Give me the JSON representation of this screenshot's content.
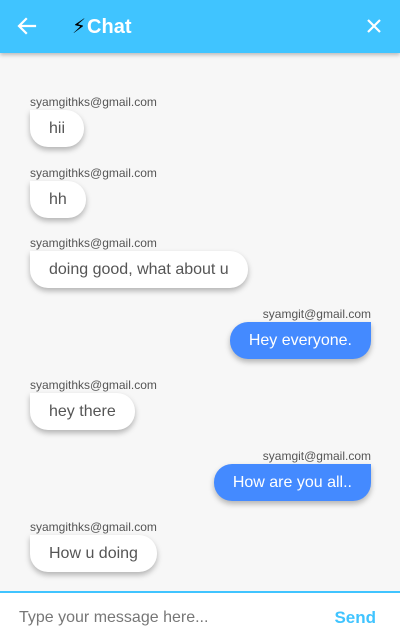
{
  "appbar": {
    "title": "Chat",
    "bolt_glyph": "⚡",
    "back_icon": "arrow-left-icon",
    "close_icon": "close-icon",
    "background_color": "#40c4ff"
  },
  "messages": [
    {
      "sender": "syamgithks@gmail.com",
      "text": "hii",
      "direction": "received"
    },
    {
      "sender": "syamgithks@gmail.com",
      "text": "hh",
      "direction": "received"
    },
    {
      "sender": "syamgithks@gmail.com",
      "text": "doing good, what about u",
      "direction": "received"
    },
    {
      "sender": "syamgit@gmail.com",
      "text": "Hey everyone.",
      "direction": "sent"
    },
    {
      "sender": "syamgithks@gmail.com",
      "text": "hey there",
      "direction": "received"
    },
    {
      "sender": "syamgit@gmail.com",
      "text": "How are you all..",
      "direction": "sent"
    },
    {
      "sender": "syamgithks@gmail.com",
      "text": "How u doing",
      "direction": "received"
    }
  ],
  "composer": {
    "placeholder": "Type your message here...",
    "value": "",
    "send_label": "Send"
  },
  "colors": {
    "accent": "#40c4ff",
    "sent_bubble": "#448aff",
    "received_bubble": "#ffffff"
  }
}
